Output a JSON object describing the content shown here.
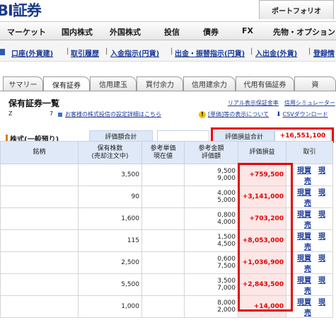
{
  "header": {
    "logo": "BI証券",
    "portfolio_button": "ポートフォリオ"
  },
  "main_nav": [
    "マーケット",
    "国内株式",
    "外国株式",
    "投信",
    "債券",
    "FX",
    "先物・オプション"
  ],
  "sub_nav": [
    "口座(外貨建)",
    "取引履歴",
    "入金指示(円貨)",
    "出金・振替指示(円貨)",
    "入出金(外貨)",
    "登録情"
  ],
  "tabs": [
    "サマリー",
    "保有証券",
    "信用建玉",
    "買付余力",
    "信用建余力",
    "代用有価証券",
    "資"
  ],
  "section": {
    "title": "保有証券一覧",
    "link_real": "リアル表示保証金率",
    "link_sim": "信用シミュレーター",
    "row_prefix": "Z",
    "count": "7",
    "notice_link": "お客様の株式投信の設定詳細はこちら",
    "unit_link": "[単価]等の表示について",
    "csv_link": "CSVダウンロード"
  },
  "stock": {
    "heading": "株式(一般預り)",
    "eval_total_label": "評価額合計",
    "eval_total_value": "",
    "pl_total_label": "評価損益合計",
    "pl_total_value": "+16,551,100",
    "columns": {
      "name": "銘柄",
      "qty_1": "保有株数",
      "qty_2": "(売却注文中)",
      "ref_1": "参考単価",
      "ref_2": "現在値",
      "amt_1": "参考金額",
      "amt_2": "評価額",
      "pl": "評価損益",
      "trade": "取引"
    },
    "rows": [
      {
        "qty": "3,500",
        "amt_a": "9,500",
        "amt_b": "9,000",
        "pl": "+759,500",
        "buy": "現買",
        "sell": "現売"
      },
      {
        "qty": "90",
        "amt_a": "4,000",
        "amt_b": "5,000",
        "pl": "+3,141,000",
        "buy": "現買",
        "sell": "現売"
      },
      {
        "qty": "1,600",
        "amt_a": "0,800",
        "amt_b": "4,000",
        "pl": "+703,200",
        "buy": "現買",
        "sell": "現売"
      },
      {
        "qty": "115",
        "amt_a": "1,500",
        "amt_b": "4,500",
        "pl": "+8,053,000",
        "buy": "現買",
        "sell": "現売"
      },
      {
        "qty": "2,500",
        "amt_a": "0,600",
        "amt_b": "7,500",
        "pl": "+1,036,900",
        "buy": "現買",
        "sell": "現売"
      },
      {
        "qty": "5,500",
        "amt_a": "3,500",
        "amt_b": "7,000",
        "pl": "+2,843,500",
        "buy": "現買",
        "sell": "現売"
      },
      {
        "qty": "1,000",
        "amt_a": "8,000",
        "amt_b": "2,000",
        "pl": "+14,000",
        "buy": "現買",
        "sell": "現売"
      }
    ]
  },
  "colors": {
    "brand": "#1a3a8a",
    "link": "#1a3a9a",
    "profit": "#e00000",
    "highlight_box": "#e60000",
    "header_cell": "#dfe9f7"
  }
}
